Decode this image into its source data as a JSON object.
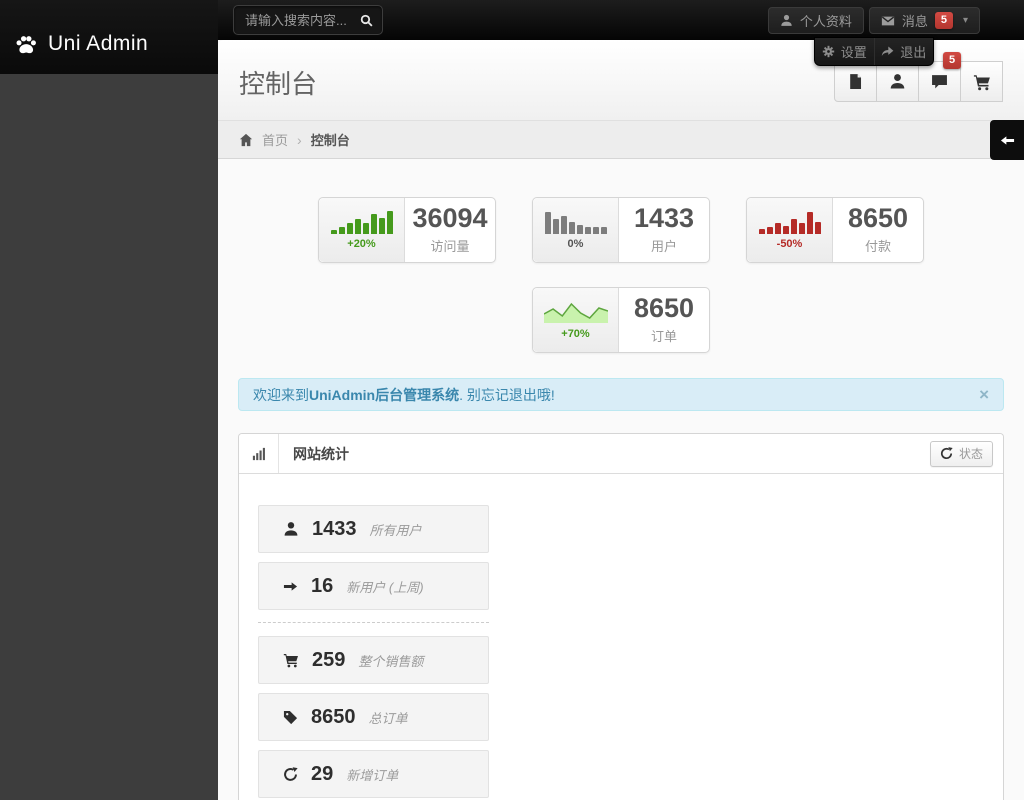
{
  "topbar": {
    "brand": "Uni Admin",
    "search": {
      "placeholder": "请输入搜索内容..."
    },
    "profile_label": "个人资料",
    "messages_label": "消息",
    "messages_badge": "5",
    "caret_glyph": "▾"
  },
  "user_menu": {
    "settings_label": "设置",
    "logout_label": "退出"
  },
  "header": {
    "title": "控制台",
    "chat_badge": "5"
  },
  "breadcrumb": {
    "home_label": "首页",
    "separator": "›",
    "current": "控制台"
  },
  "stats": {
    "tiles": [
      {
        "type": "bar",
        "percent": "+20%",
        "value": "36094",
        "label": "访问量",
        "color": "#459a1c",
        "percent_color": "#459a1c",
        "spark": [
          4,
          7,
          11,
          15,
          11,
          20,
          16,
          23
        ]
      },
      {
        "type": "bar",
        "percent": "0%",
        "value": "1433",
        "label": "用户",
        "color": "#7d7d7d",
        "percent_color": "#555555",
        "spark": [
          22,
          15,
          18,
          12,
          9,
          7,
          7,
          7
        ]
      },
      {
        "type": "bar",
        "percent": "-50%",
        "value": "8650",
        "label": "付款",
        "color": "#b52b27",
        "percent_color": "#b52b27",
        "spark": [
          5,
          7,
          11,
          8,
          15,
          11,
          22,
          12
        ]
      },
      {
        "type": "area",
        "percent": "+70%",
        "value": "8650",
        "label": "订单",
        "color": "#5ea63f",
        "percent_color": "#459a1c",
        "fill": "#c9f2ad",
        "points": [
          13,
          8,
          15,
          3,
          12,
          17,
          7,
          10
        ]
      }
    ]
  },
  "alert": {
    "prefix": "欢迎来到",
    "bold": "UniAdmin后台管理系统",
    "suffix": ". 别忘记退出哦!",
    "close_glyph": "×"
  },
  "panel": {
    "title": "网站统计",
    "status_label": "状态",
    "items": [
      {
        "icon": "user",
        "value": "1433",
        "label": "所有用户"
      },
      {
        "icon": "arrow-right",
        "value": "16",
        "label": "新用户 (上周)"
      },
      {
        "icon": "cart",
        "value": "259",
        "label": "整个销售额"
      },
      {
        "icon": "tag",
        "value": "8650",
        "label": "总订单"
      },
      {
        "icon": "refresh",
        "value": "29",
        "label": "新增订单"
      }
    ]
  },
  "icons": {
    "paw": "🐾",
    "search": "🔍",
    "user": "👤",
    "mail": "✉",
    "gear": "⚙",
    "logout": "➦",
    "file": "📄",
    "comment": "💬",
    "cart": "🛒",
    "home": "🏠",
    "signal": "📶",
    "refresh": "↻",
    "tag": "🏷",
    "arrow-right": "→",
    "arrow-left": "←",
    "caret-down": "▾",
    "close": "×"
  }
}
